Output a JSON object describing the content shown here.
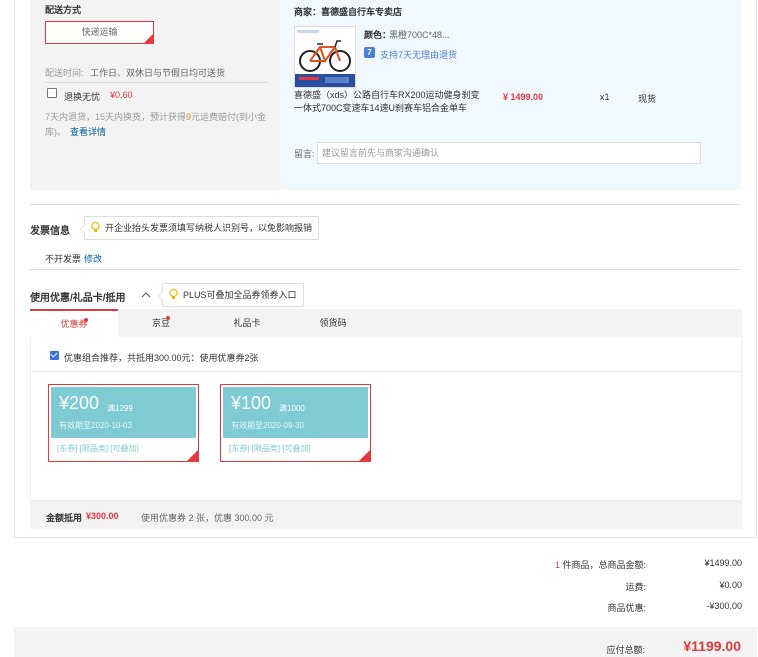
{
  "shipping": {
    "title": "配送方式",
    "method_button": "快递运输",
    "time_label": "配送时间:",
    "time_value": "工作日、双休日与节假日均可送货",
    "return_label": "退换无忧",
    "return_price": "¥0.60",
    "return_desc_1": "7天内退货，15天内换货，预计获得",
    "return_desc_highlight": "9",
    "return_desc_2": "元运费赔付(到小金库)。",
    "return_link": "查看详情"
  },
  "merchant": {
    "name": "商家：喜德盛自行车专卖店",
    "product": {
      "color_label": "颜色：",
      "color_value": "黑橙700C*48...",
      "return_badge": "7",
      "return_policy": "支持7天无理由退货",
      "title": "喜德盛（xds）公路自行车RX200运动健身刹变一体式700C变速车14速U刹赛车铝合金单车",
      "price": "¥ 1499.00",
      "qty": "x1",
      "stock": "现货"
    },
    "remark_label": "留言:",
    "remark_placeholder": "建议留言前先与商家沟通确认"
  },
  "invoice": {
    "title": "发票信息",
    "tip": "开企业抬头发票须填写纳税人识别号，以免影响报销",
    "status": "不开发票",
    "edit_link": "修改"
  },
  "coupons": {
    "title": "使用优惠/礼品卡/抵用",
    "tip": "PLUS可叠加全品券领券入口",
    "tabs": [
      {
        "label": "优惠券",
        "dot": true
      },
      {
        "label": "京豆",
        "dot": true
      },
      {
        "label": "礼品卡",
        "dot": false
      },
      {
        "label": "领货码",
        "dot": false
      }
    ],
    "combo_text": "优惠组合推荐，共抵用300.00元：使用优惠券2张",
    "items": [
      {
        "amount": "¥200",
        "condition": "满1299",
        "valid": "有效期至2020-10-03",
        "tags": "[东券] [限品类] [可叠加]"
      },
      {
        "amount": "¥100",
        "condition": "满1000",
        "valid": "有效期至2020-09-30",
        "tags": "[东券] [限品类] [可叠加]"
      }
    ],
    "summary_label": "金额抵用",
    "summary_amount": "¥300.00",
    "summary_desc": "使用优惠券 2 张，优惠 300.00 元"
  },
  "totals": {
    "count": "1",
    "count_suffix": " 件商品，总商品金额:",
    "goods_amount": "¥1499.00",
    "freight_label": "运费:",
    "freight_value": "¥0.00",
    "discount_label": "商品优惠:",
    "discount_value": "-¥300.00",
    "pay_label": "应付总额:",
    "pay_amount": "¥1199.00"
  },
  "colors": {
    "accent_red": "#e4393c",
    "link_blue": "#005ea7",
    "coupon_teal": "#7ecbd3",
    "merchant_bg": "#f1f8ff"
  }
}
